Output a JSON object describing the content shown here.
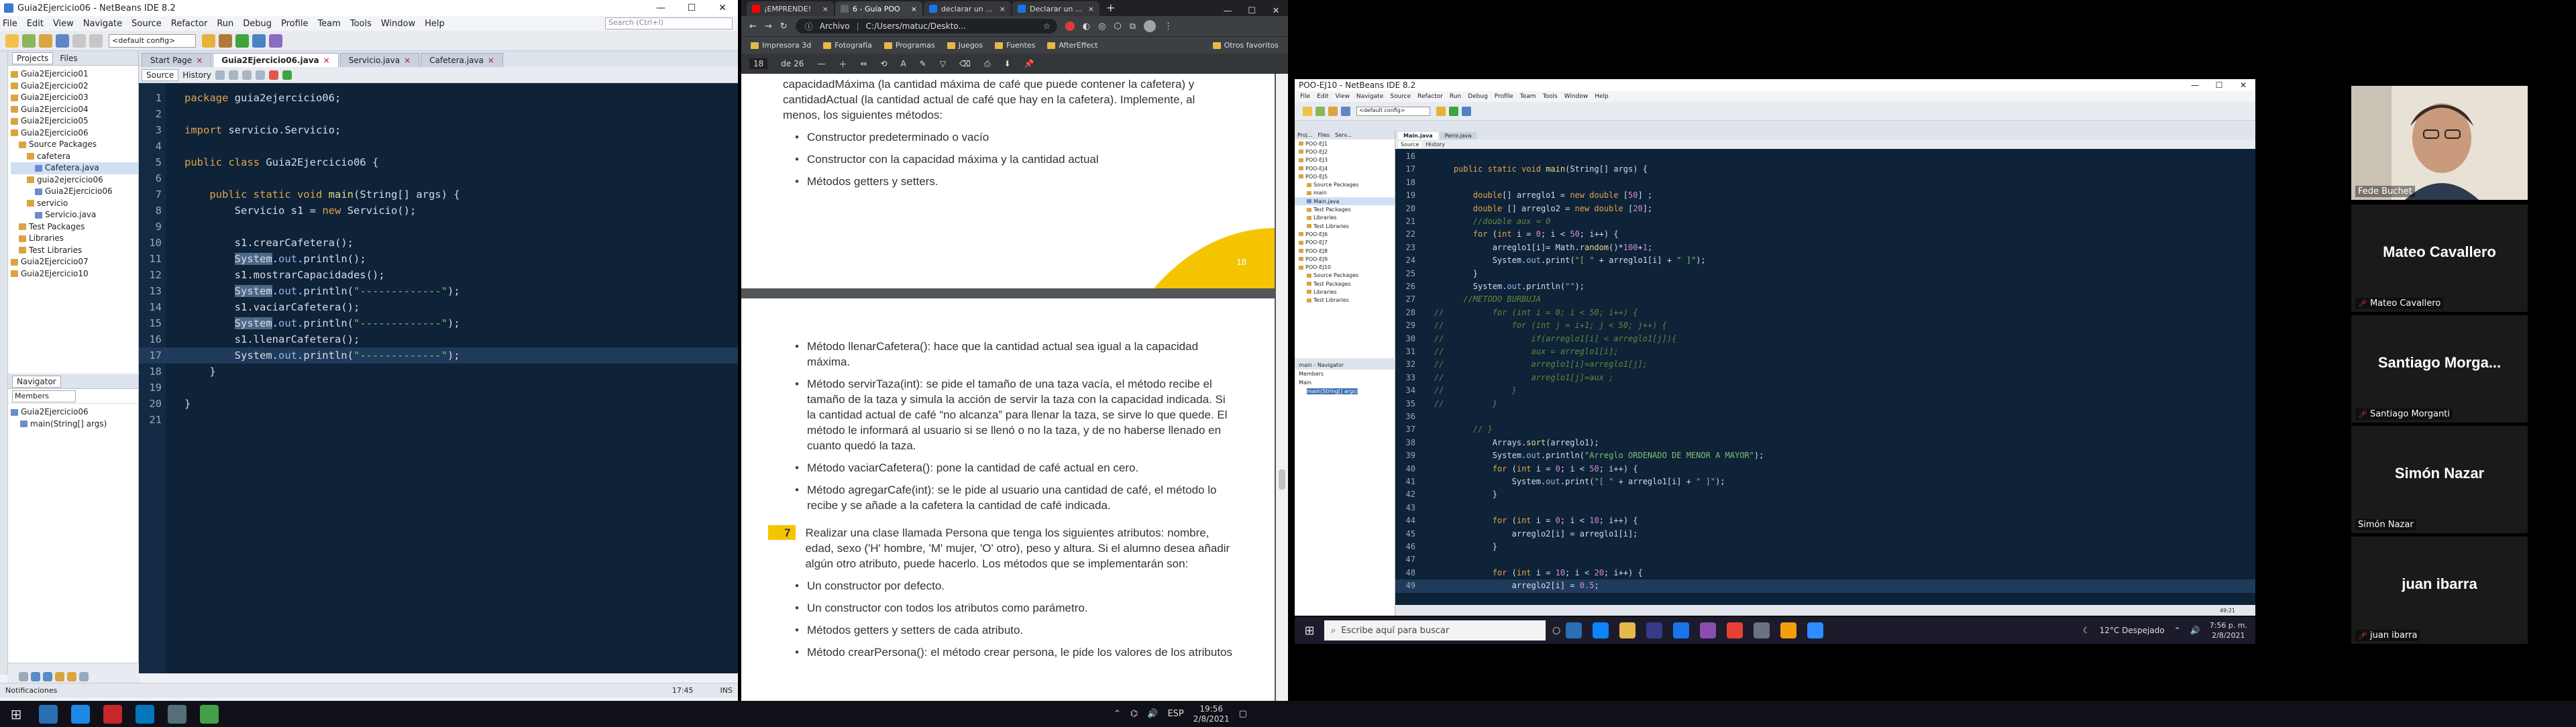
{
  "netbeans": {
    "title": "Guia2Ejercicio06 - NetBeans IDE 8.2",
    "menu": [
      "File",
      "Edit",
      "View",
      "Navigate",
      "Source",
      "Refactor",
      "Run",
      "Debug",
      "Profile",
      "Team",
      "Tools",
      "Window",
      "Help"
    ],
    "search_placeholder": "Search (Ctrl+I)",
    "config": "<default config>",
    "projects_tab": "Projects",
    "files_tab": "Files",
    "project_tree": [
      {
        "label": "Guia2Ejercicio01",
        "depth": 0,
        "kind": "project"
      },
      {
        "label": "Guia2Ejercicio02",
        "depth": 0,
        "kind": "project"
      },
      {
        "label": "Guia2Ejercicio03",
        "depth": 0,
        "kind": "project"
      },
      {
        "label": "Guia2Ejercicio04",
        "depth": 0,
        "kind": "project"
      },
      {
        "label": "Guia2Ejercicio05",
        "depth": 0,
        "kind": "project"
      },
      {
        "label": "Guia2Ejercicio06",
        "depth": 0,
        "kind": "project"
      },
      {
        "label": "Source Packages",
        "depth": 1,
        "kind": "folder"
      },
      {
        "label": "cafetera",
        "depth": 2,
        "kind": "folder"
      },
      {
        "label": "Cafetera.java",
        "depth": 3,
        "kind": "java",
        "selected": true
      },
      {
        "label": "guia2ejercicio06",
        "depth": 2,
        "kind": "folder"
      },
      {
        "label": "Guia2Ejercicio06",
        "depth": 3,
        "kind": "java"
      },
      {
        "label": "servicio",
        "depth": 2,
        "kind": "folder"
      },
      {
        "label": "Servicio.java",
        "depth": 3,
        "kind": "java"
      },
      {
        "label": "Test Packages",
        "depth": 1,
        "kind": "folder"
      },
      {
        "label": "Libraries",
        "depth": 1,
        "kind": "folder"
      },
      {
        "label": "Test Libraries",
        "depth": 1,
        "kind": "folder"
      },
      {
        "label": "Guia2Ejercicio07",
        "depth": 0,
        "kind": "project"
      },
      {
        "label": "Guia2Ejercicio10",
        "depth": 0,
        "kind": "project"
      }
    ],
    "navigator_title": "Navigator",
    "navigator_select": "Members",
    "navigator_items": [
      "Guia2Ejercicio06",
      "main(String[] args)"
    ],
    "tabs": [
      {
        "label": "Start Page",
        "active": false
      },
      {
        "label": "Guia2Ejercicio06.java",
        "active": true
      },
      {
        "label": "Servicio.java",
        "active": false
      },
      {
        "label": "Cafetera.java",
        "active": false
      }
    ],
    "source_tab": "Source",
    "history_tab": "History",
    "code_lines": [
      {
        "n": "1",
        "html": "<span class='kw'>package</span> guia2ejercicio06;"
      },
      {
        "n": "2",
        "html": ""
      },
      {
        "n": "3",
        "html": "<span class='kw'>import</span> servicio.Servicio;"
      },
      {
        "n": "4",
        "html": ""
      },
      {
        "n": "5",
        "html": "<span class='kw'>public class</span> Guia2Ejercicio06 {"
      },
      {
        "n": "6",
        "html": ""
      },
      {
        "n": "7",
        "html": "    <span class='kw'>public static void</span> <span class='fn'>main</span>(String[] args) {"
      },
      {
        "n": "8",
        "html": "        Servicio s1 = <span class='kw'>new</span> Servicio();"
      },
      {
        "n": "9",
        "html": ""
      },
      {
        "n": "10",
        "html": "        s1.crearCafetera();"
      },
      {
        "n": "11",
        "html": "        <span class='hl'>System</span>.<span class='cls'>out</span>.println();"
      },
      {
        "n": "12",
        "html": "        s1.mostrarCapacidades();"
      },
      {
        "n": "13",
        "html": "        <span class='hl'>System</span>.<span class='cls'>out</span>.println(<span class='str'>\"-------------\"</span>);"
      },
      {
        "n": "14",
        "html": "        s1.vaciarCafetera();"
      },
      {
        "n": "15",
        "html": "        <span class='hl'>System</span>.<span class='cls'>out</span>.println(<span class='str'>\"-------------\"</span>);"
      },
      {
        "n": "16",
        "html": "        s1.llenarCafetera();"
      },
      {
        "n": "17",
        "html": "        System.<span class='cls'>out</span>.println(<span class='str'>\"-------------\"</span>);",
        "current": true
      },
      {
        "n": "18",
        "html": "    }"
      },
      {
        "n": "19",
        "html": ""
      },
      {
        "n": "20",
        "html": "}"
      },
      {
        "n": "21",
        "html": ""
      }
    ],
    "status_left": "Notificaciones",
    "status_pos": "17:45",
    "status_ins": "INS"
  },
  "browser": {
    "tabs": [
      {
        "label": "¡EMPRENDE!",
        "active": false
      },
      {
        "label": "6 - Guía POO",
        "active": true
      },
      {
        "label": "declarar un ...",
        "active": false
      },
      {
        "label": "Declarar un ...",
        "active": false
      }
    ],
    "address_prefix": "Archivo",
    "address": "C:/Users/matuc/Deskto...",
    "bookmarks": [
      "Impresora 3d",
      "Fotografía",
      "Programas",
      "Juegos",
      "Fuentes",
      "AfterEffect",
      "Otros favoritos"
    ],
    "pdf_page": "18",
    "pdf_total": "de 26",
    "page1_text": "capacidadMáxima (la cantidad máxima de café que puede contener la cafetera) y cantidadActual (la cantidad actual de café que hay en la cafetera). Implemente, al menos, los siguientes métodos:",
    "page1_bullets": [
      "Constructor predeterminado o vacío",
      "Constructor con la capacidad máxima y la cantidad actual",
      "Métodos getters y setters."
    ],
    "page_number": "18",
    "page2_bullets": [
      "Método llenarCafetera(): hace que la cantidad actual sea igual a la capacidad máxima.",
      "Método servirTaza(int): se pide el tamaño de una taza vacía, el método recibe el tamaño de la taza y simula la acción de servir la taza con la capacidad indicada. Si la cantidad actual de café “no alcanza” para llenar la taza, se sirve lo que quede. El método le informará al usuario si se llenó o no la taza, y de no haberse llenado en cuanto quedó la taza.",
      "Método vaciarCafetera(): pone la cantidad de café actual en cero.",
      "Método agregarCafe(int): se le pide al usuario una cantidad de café, el método lo recibe y se añade a la cafetera la cantidad de café indicada."
    ],
    "exercise_number": "7",
    "exercise_text": "Realizar una clase llamada Persona que tenga los siguientes atributos: nombre, edad, sexo ('H' hombre, 'M' mujer, 'O' otro), peso y altura. Si el alumno desea añadir algún otro atributo, puede hacerlo. Los métodos que se implementarán son:",
    "page2_bullets_b": [
      "Un constructor por defecto.",
      "Un constructor con todos los atributos como parámetro.",
      "Métodos getters y setters de cada atributo.",
      "Método crearPersona(): el método crear persona, le pide los valores de los atributos"
    ]
  },
  "shared": {
    "title": "POO-EJ10 - NetBeans IDE 8.2",
    "menu": [
      "File",
      "Edit",
      "View",
      "Navigate",
      "Source",
      "Refactor",
      "Run",
      "Debug",
      "Profile",
      "Team",
      "Tools",
      "Window",
      "Help"
    ],
    "config": "<default config>",
    "project_items": [
      "POO-EJ1",
      "POO-EJ2",
      "POO-EJ3",
      "POO-EJ4",
      "POO-EJ5",
      "Source Packages",
      "main",
      "Main.java",
      "Test Packages",
      "Libraries",
      "Test Libraries",
      "POO-EJ6",
      "POO-EJ7",
      "POO-EJ8",
      "POO-EJ9",
      "POO-EJ10",
      "Source Packages",
      "Test Packages",
      "Libraries",
      "Test Libraries"
    ],
    "nav_items": [
      "main - Navigator",
      "Members",
      "Main",
      "main(String[] args)"
    ],
    "tabs": [
      "Main.java",
      "Perro.java"
    ],
    "code_lines": [
      {
        "n": "16",
        "html": ""
      },
      {
        "n": "17",
        "html": "    <span class='kw'>public static void</span> <span class='fn'>main</span>(String[] args) {"
      },
      {
        "n": "18",
        "html": ""
      },
      {
        "n": "19",
        "html": "        <span class='kw'>double</span>[] arreglo1 = <span class='kw'>new double</span> [<span class='num'>50</span>] ;"
      },
      {
        "n": "20",
        "html": "        <span class='kw'>double</span> [] arreglo2 = <span class='kw'>new double</span> [<span class='num'>20</span>];"
      },
      {
        "n": "21",
        "html": "        <span class='com'>//double aux = 0</span>"
      },
      {
        "n": "22",
        "html": "        <span class='kw'>for</span> (<span class='kw'>int</span> i = <span class='num'>0</span>; i &lt; <span class='num'>50</span>; i++) {"
      },
      {
        "n": "23",
        "html": "            arreglo1[i]= Math.<span class='fn'>random</span>()*<span class='num'>100</span>+<span class='num'>1</span>;"
      },
      {
        "n": "24",
        "html": "            System.<span class='cls'>out</span>.print(<span class='str'>\"[ \"</span> + arreglo1[i] + <span class='str'>\" ]\"</span>);"
      },
      {
        "n": "25",
        "html": "        }"
      },
      {
        "n": "26",
        "html": "        System.<span class='cls'>out</span>.println(<span class='str'>\"\"</span>);"
      },
      {
        "n": "27",
        "html": "      <span class='com'>//METODO BURBUJA</span>"
      },
      {
        "n": "28",
        "html": "<span class='com'>//          for (int i = 0; i &lt; 50; i++) {</span>"
      },
      {
        "n": "29",
        "html": "<span class='com'>//              for (int j = i+1; j &lt; 50; j++) {</span>"
      },
      {
        "n": "30",
        "html": "<span class='com'>//                  if(arreglo1[i] &lt; arreglo1[j]){</span>"
      },
      {
        "n": "31",
        "html": "<span class='com'>//                  aux = arreglo1[i];</span>"
      },
      {
        "n": "32",
        "html": "<span class='com'>//                  arreglo1[i]=arreglo1[j];</span>"
      },
      {
        "n": "33",
        "html": "<span class='com'>//                  arreglo1[j]=aux ;</span>"
      },
      {
        "n": "34",
        "html": "<span class='com'>//              }</span>"
      },
      {
        "n": "35",
        "html": "<span class='com'>//          }</span>"
      },
      {
        "n": "36",
        "html": ""
      },
      {
        "n": "37",
        "html": "        <span class='com'>// }</span>"
      },
      {
        "n": "38",
        "html": "            Arrays.<span class='fn'>sort</span>(arreglo1);"
      },
      {
        "n": "39",
        "html": "            System.<span class='cls'>out</span>.println(<span class='str'>\"Arreglo ORDENADO DE MENOR A MAYOR\"</span>);"
      },
      {
        "n": "40",
        "html": "            <span class='kw'>for</span> (<span class='kw'>int</span> i = <span class='num'>0</span>; i &lt; <span class='num'>50</span>; i++) {"
      },
      {
        "n": "41",
        "html": "                System.<span class='cls'>out</span>.print(<span class='str'>\"[ \"</span> + arreglo1[i] + <span class='str'>\" ]\"</span>);"
      },
      {
        "n": "42",
        "html": "            }"
      },
      {
        "n": "43",
        "html": ""
      },
      {
        "n": "44",
        "html": "            <span class='kw'>for</span> (<span class='kw'>int</span> i = <span class='num'>0</span>; i &lt; <span class='num'>10</span>; i++) {"
      },
      {
        "n": "45",
        "html": "                arreglo2[i] = arreglo1[i];"
      },
      {
        "n": "46",
        "html": "            }"
      },
      {
        "n": "47",
        "html": ""
      },
      {
        "n": "48",
        "html": "            <span class='kw'>for</span> (<span class='kw'>int</span> i = <span class='num'>10</span>; i &lt; <span class='num'>20</span>; i++) {"
      },
      {
        "n": "49",
        "html": "                arreglo2[i] = <span class='num'>0.5</span>;",
        "current": true
      }
    ],
    "taskbar_search": "Escribe aquí para buscar",
    "weather": "12°C Despejado",
    "clock_time": "7:56 p. m.",
    "clock_date": "2/8/2021",
    "status_pos": "49:21"
  },
  "participants": [
    {
      "big": "",
      "small": "Fede Buchet",
      "muted": false,
      "video": true
    },
    {
      "big": "Mateo Cavallero",
      "small": "Mateo Cavallero",
      "muted": true
    },
    {
      "big": "Santiago  Morga...",
      "small": "Santiago Morganti",
      "muted": true
    },
    {
      "big": "Simón Nazar",
      "small": "Simón Nazar",
      "muted": false
    },
    {
      "big": "juan ibarra",
      "small": "juan ibarra",
      "muted": true
    }
  ],
  "taskbar": {
    "lang": "ESP",
    "time": "19:56",
    "date": "2/8/2021"
  },
  "colors": {
    "editor_bg": "#0e2238",
    "keyword": "#e3a34b",
    "string": "#7ec16e",
    "pdf_accent": "#f5c400",
    "muted_mic": "#e53935"
  }
}
